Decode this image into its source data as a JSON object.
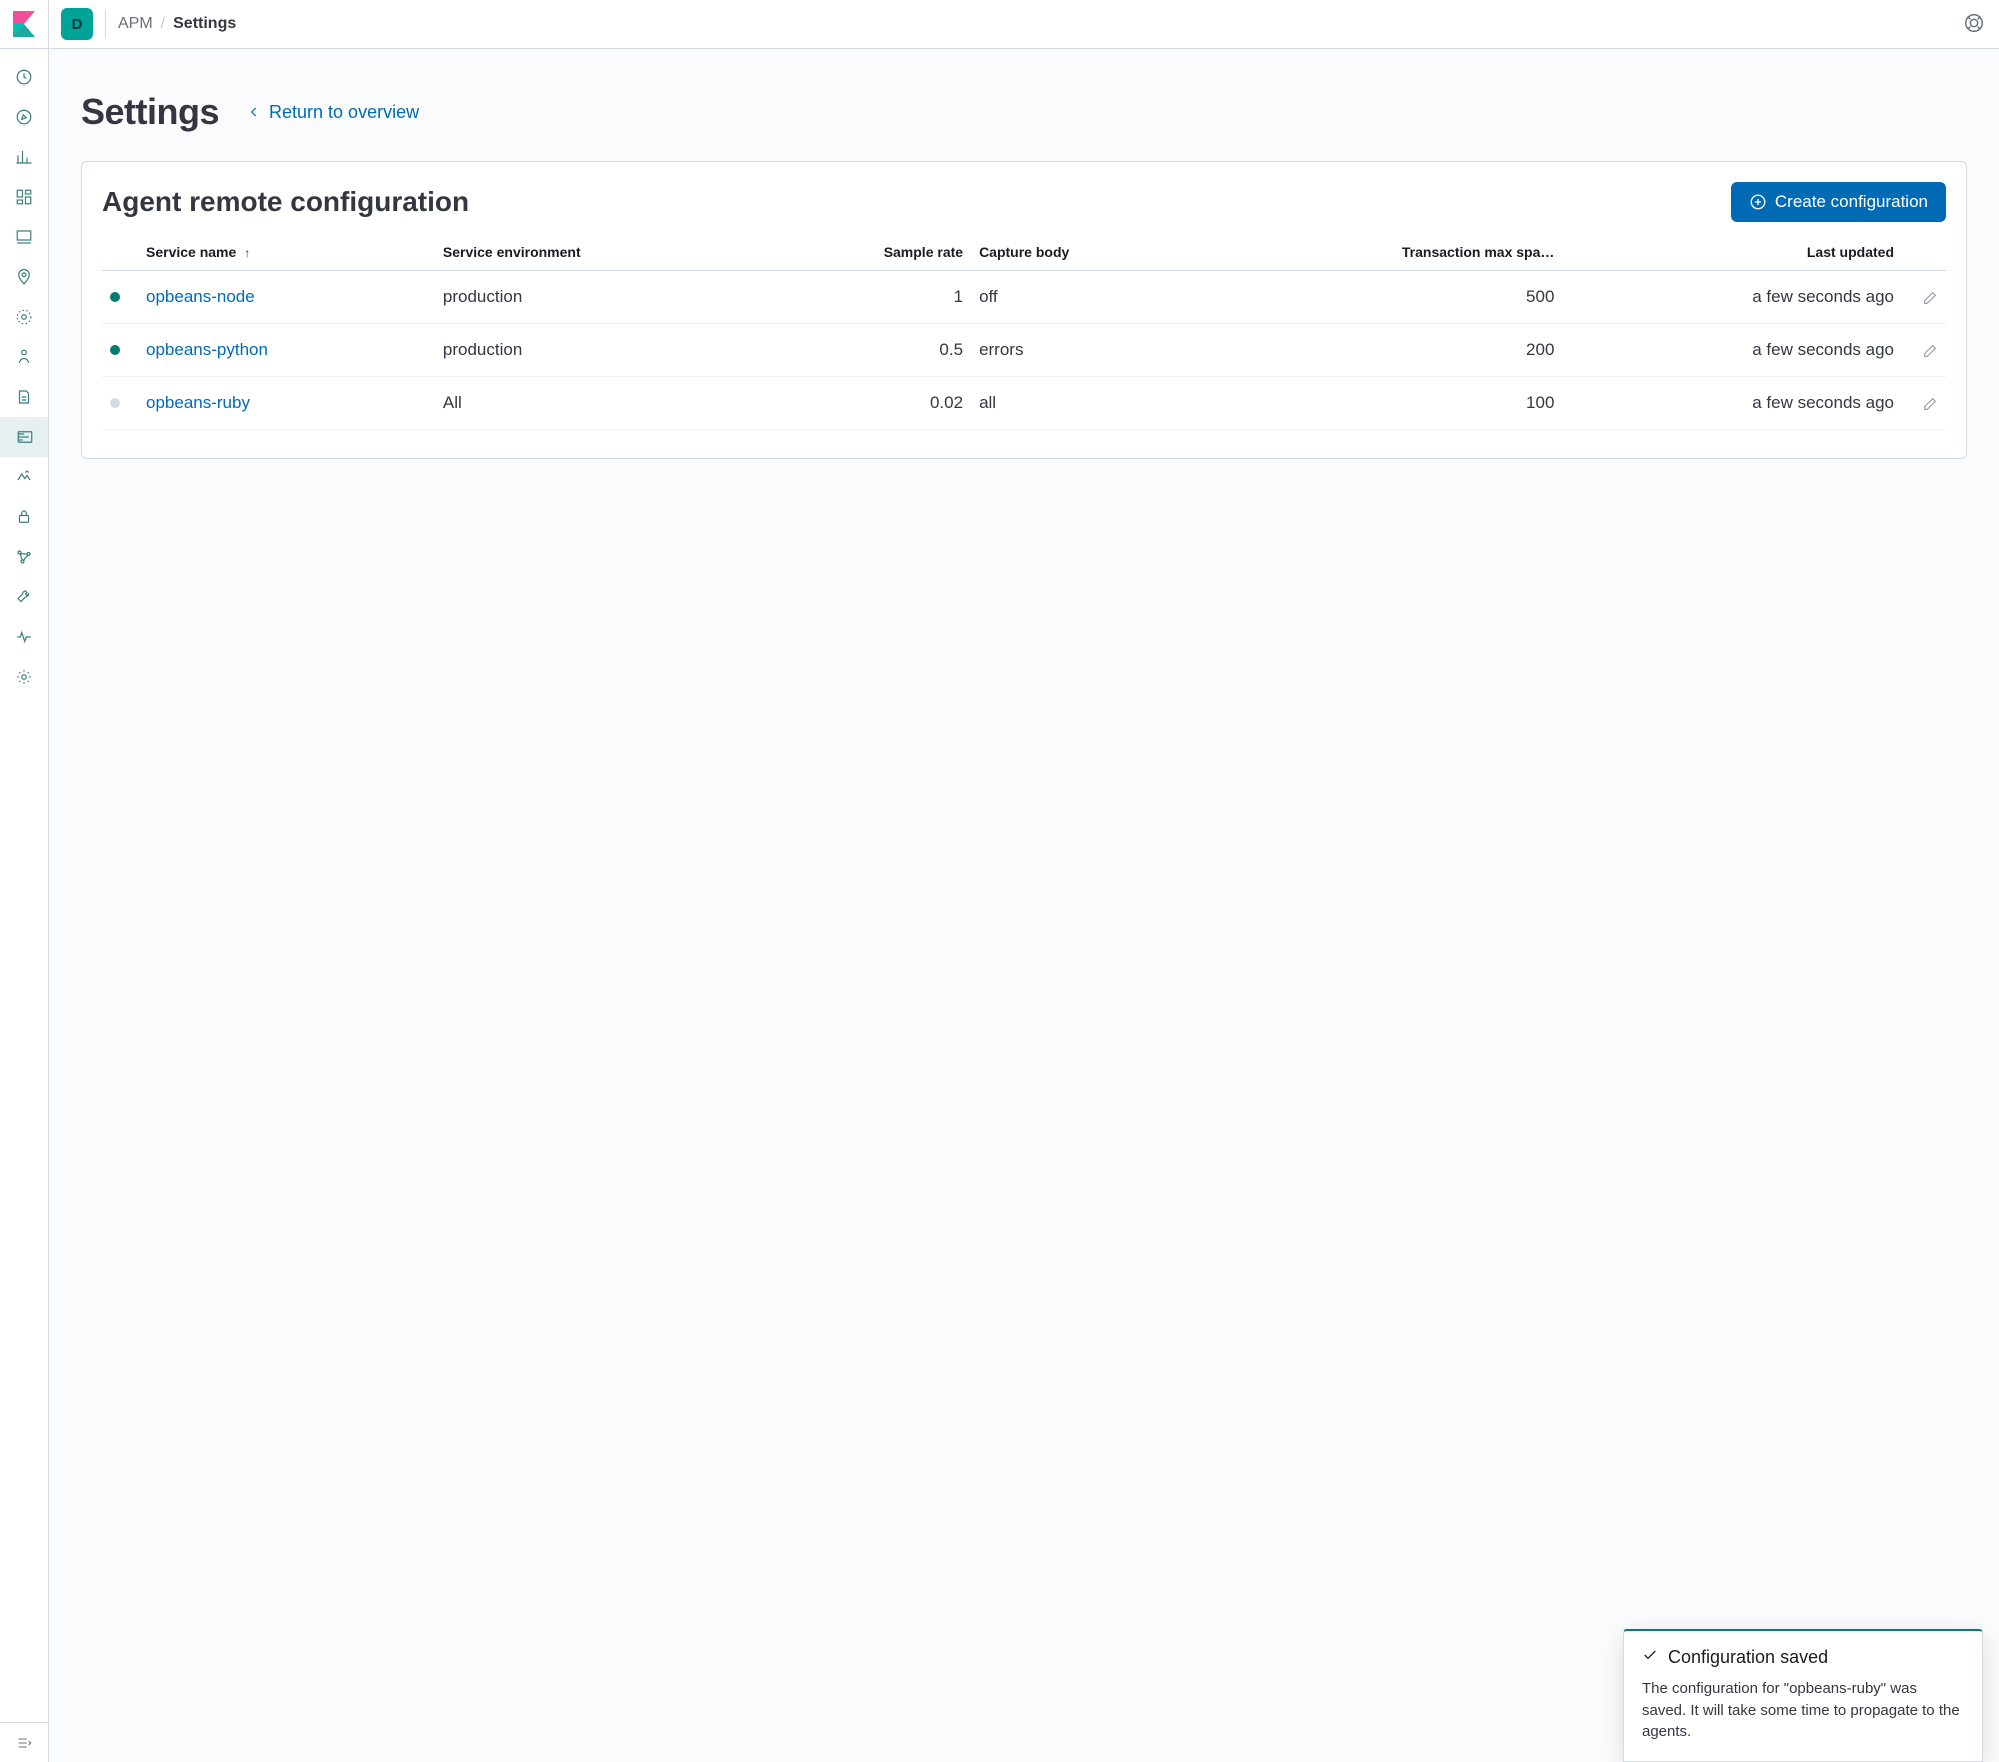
{
  "space_letter": "D",
  "breadcrumbs": {
    "0": "APM",
    "1": "Settings"
  },
  "page": {
    "title": "Settings",
    "return_label": "Return to overview"
  },
  "panel": {
    "title": "Agent remote configuration",
    "create_button": "Create configuration",
    "columns": {
      "status": "",
      "service_name": "Service name",
      "environment": "Service environment",
      "sample_rate": "Sample rate",
      "capture_body": "Capture body",
      "max_spans": "Transaction max spa…",
      "last_updated": "Last updated"
    },
    "rows": [
      {
        "status": "on",
        "service": "opbeans-node",
        "environment": "production",
        "sample_rate": "1",
        "capture_body": "off",
        "max_spans": "500",
        "last_updated": "a few seconds ago"
      },
      {
        "status": "on",
        "service": "opbeans-python",
        "environment": "production",
        "sample_rate": "0.5",
        "capture_body": "errors",
        "max_spans": "200",
        "last_updated": "a few seconds ago"
      },
      {
        "status": "off",
        "service": "opbeans-ruby",
        "environment": "All",
        "sample_rate": "0.02",
        "capture_body": "all",
        "max_spans": "100",
        "last_updated": "a few seconds ago"
      }
    ]
  },
  "toast": {
    "title": "Configuration saved",
    "body": "The configuration for \"opbeans-ruby\" was saved. It will take some time to propagate to the agents."
  },
  "rail_icons": [
    "recent-icon",
    "discover-icon",
    "visualize-icon",
    "dashboard-icon",
    "canvas-icon",
    "maps-icon",
    "ml-icon",
    "infrastructure-icon",
    "logs-icon",
    "apm-icon",
    "uptime-icon",
    "siem-icon",
    "graph-icon",
    "devtools-icon",
    "monitoring-icon",
    "management-icon"
  ]
}
